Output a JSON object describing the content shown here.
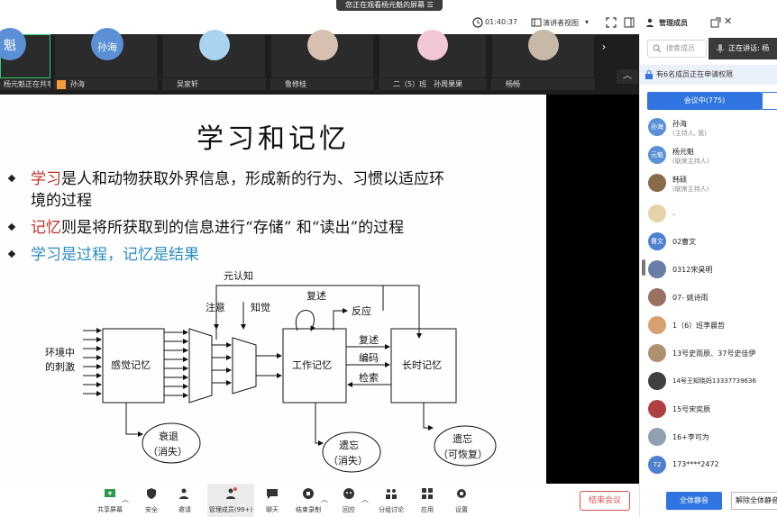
{
  "banner": {
    "text": "您正在观看杨元魁的屏幕"
  },
  "topbar": {
    "timer": "01:40:37",
    "view_label": "演讲者视图",
    "panel_title": "管理成员"
  },
  "strip": {
    "tiles": [
      {
        "name": "杨元魁正在共享",
        "avatar_text": "魁"
      },
      {
        "name": "孙海",
        "avatar_text": "孙海"
      },
      {
        "name": "吴家轩",
        "avatar_text": ""
      },
      {
        "name": "鲁修桂",
        "avatar_text": ""
      },
      {
        "name": "二（5）班　孙周果果",
        "avatar_text": ""
      },
      {
        "name": "畅畅",
        "avatar_text": ""
      }
    ]
  },
  "slide": {
    "title": "学习和记忆",
    "bullet1_red": "学习",
    "bullet1_rest": "是人和动物获取外界信息，形成新的行为、习惯以适应环",
    "bullet1_cont": "境的过程",
    "bullet2_red": "记忆",
    "bullet2_rest": "则是将所获取到的信息进行“存储” 和“读出”的过程",
    "bullet3": "学习是过程，记忆是结果",
    "diagram": {
      "meta": "元认知",
      "repeat_top": "复述",
      "attention": "注意",
      "perception": "知觉",
      "reaction": "反应",
      "stimulus_l1": "环境中",
      "stimulus_l2": "的刺激",
      "sensory": "感觉记忆",
      "working": "工作记忆",
      "longterm": "长时记忆",
      "rehearse": "复述",
      "encode": "编码",
      "retrieve": "检索",
      "decay_l1": "衰退",
      "decay_l2": "（消失）",
      "forget1_l1": "遗忘",
      "forget1_l2": "（消失）",
      "forget2_l1": "遗忘",
      "forget2_l2": "（可恢复）"
    }
  },
  "toolbar": {
    "share": "共享屏幕",
    "security": "安全",
    "invite": "邀请",
    "members": "管理成员(99+)",
    "chat": "聊天",
    "record": "结束录制",
    "reactions": "回应",
    "breakout": "分组讨论",
    "apps": "应用",
    "settings": "设置",
    "end": "结束会议"
  },
  "panel": {
    "search_placeholder": "搜索成员",
    "speaking": "正在讲话: 杨",
    "waiting": "有6名成员正在申请权限",
    "tab_active": "会议中(775)",
    "members": [
      {
        "name": "孙海",
        "sub": "(主持人, 我)",
        "avatar": "孙海",
        "color": "#5b8fd6"
      },
      {
        "name": "杨元魁",
        "sub": "(联席主持人)",
        "avatar": "元魁",
        "color": "#5b8fd6"
      },
      {
        "name": "韩硕",
        "sub": "(联席主持人)",
        "avatar": "",
        "color": "#8a6a4a"
      },
      {
        "name": ".",
        "sub": "",
        "avatar": "",
        "color": "#e6d2a8"
      },
      {
        "name": "02曹文",
        "sub": "",
        "avatar": "曹文",
        "color": "#4f7fcf"
      },
      {
        "name": "0312宋昊明",
        "sub": "",
        "avatar": "",
        "color": "#6a7fa8"
      },
      {
        "name": "07- 姚诗雨",
        "sub": "",
        "avatar": "",
        "color": "#9a7060"
      },
      {
        "name": "1（6）班李晨哲",
        "sub": "",
        "avatar": "",
        "color": "#d8a070"
      },
      {
        "name": "13号史雨辰、37号史佳伊",
        "sub": "",
        "avatar": "",
        "color": "#b09070"
      },
      {
        "name": "14号王知晓妈13337739636",
        "sub": "",
        "avatar": "",
        "color": "#404040"
      },
      {
        "name": "15号宋奕辰",
        "sub": "",
        "avatar": "",
        "color": "#b04040"
      },
      {
        "name": "16+李可为",
        "sub": "",
        "avatar": "",
        "color": "#90a0b0"
      },
      {
        "name": "173****2472",
        "sub": "",
        "avatar": "72",
        "color": "#4f7fcf"
      }
    ],
    "mute_all": "全体静音",
    "unmute_all": "解除全体静音"
  }
}
